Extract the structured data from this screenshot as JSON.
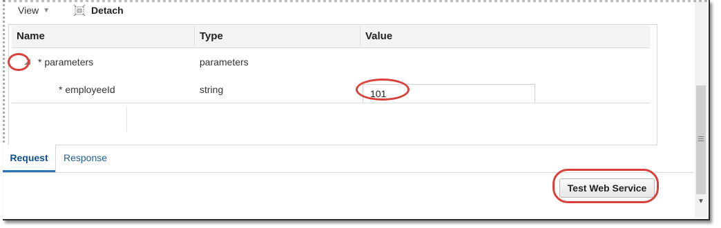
{
  "toolbar": {
    "view_label": "View",
    "view_icon": "caret-down-icon",
    "detach_label": "Detach",
    "detach_icon": "detach-icon"
  },
  "table": {
    "columns": [
      "Name",
      "Type",
      "Value"
    ],
    "rows": [
      {
        "name": "* parameters",
        "type": "parameters",
        "value": "",
        "expander_icon": "expand-collapse-triangle-icon"
      },
      {
        "name": "* employeeId",
        "type": "string",
        "value": "101"
      }
    ]
  },
  "tabs": [
    {
      "label": "Request",
      "active": true
    },
    {
      "label": "Response",
      "active": false
    }
  ],
  "footer": {
    "test_button_label": "Test Web Service"
  },
  "colors": {
    "highlight_ring": "#d9403a",
    "tab_active": "#0b4f8a",
    "link_blue": "#1e5c9a"
  }
}
